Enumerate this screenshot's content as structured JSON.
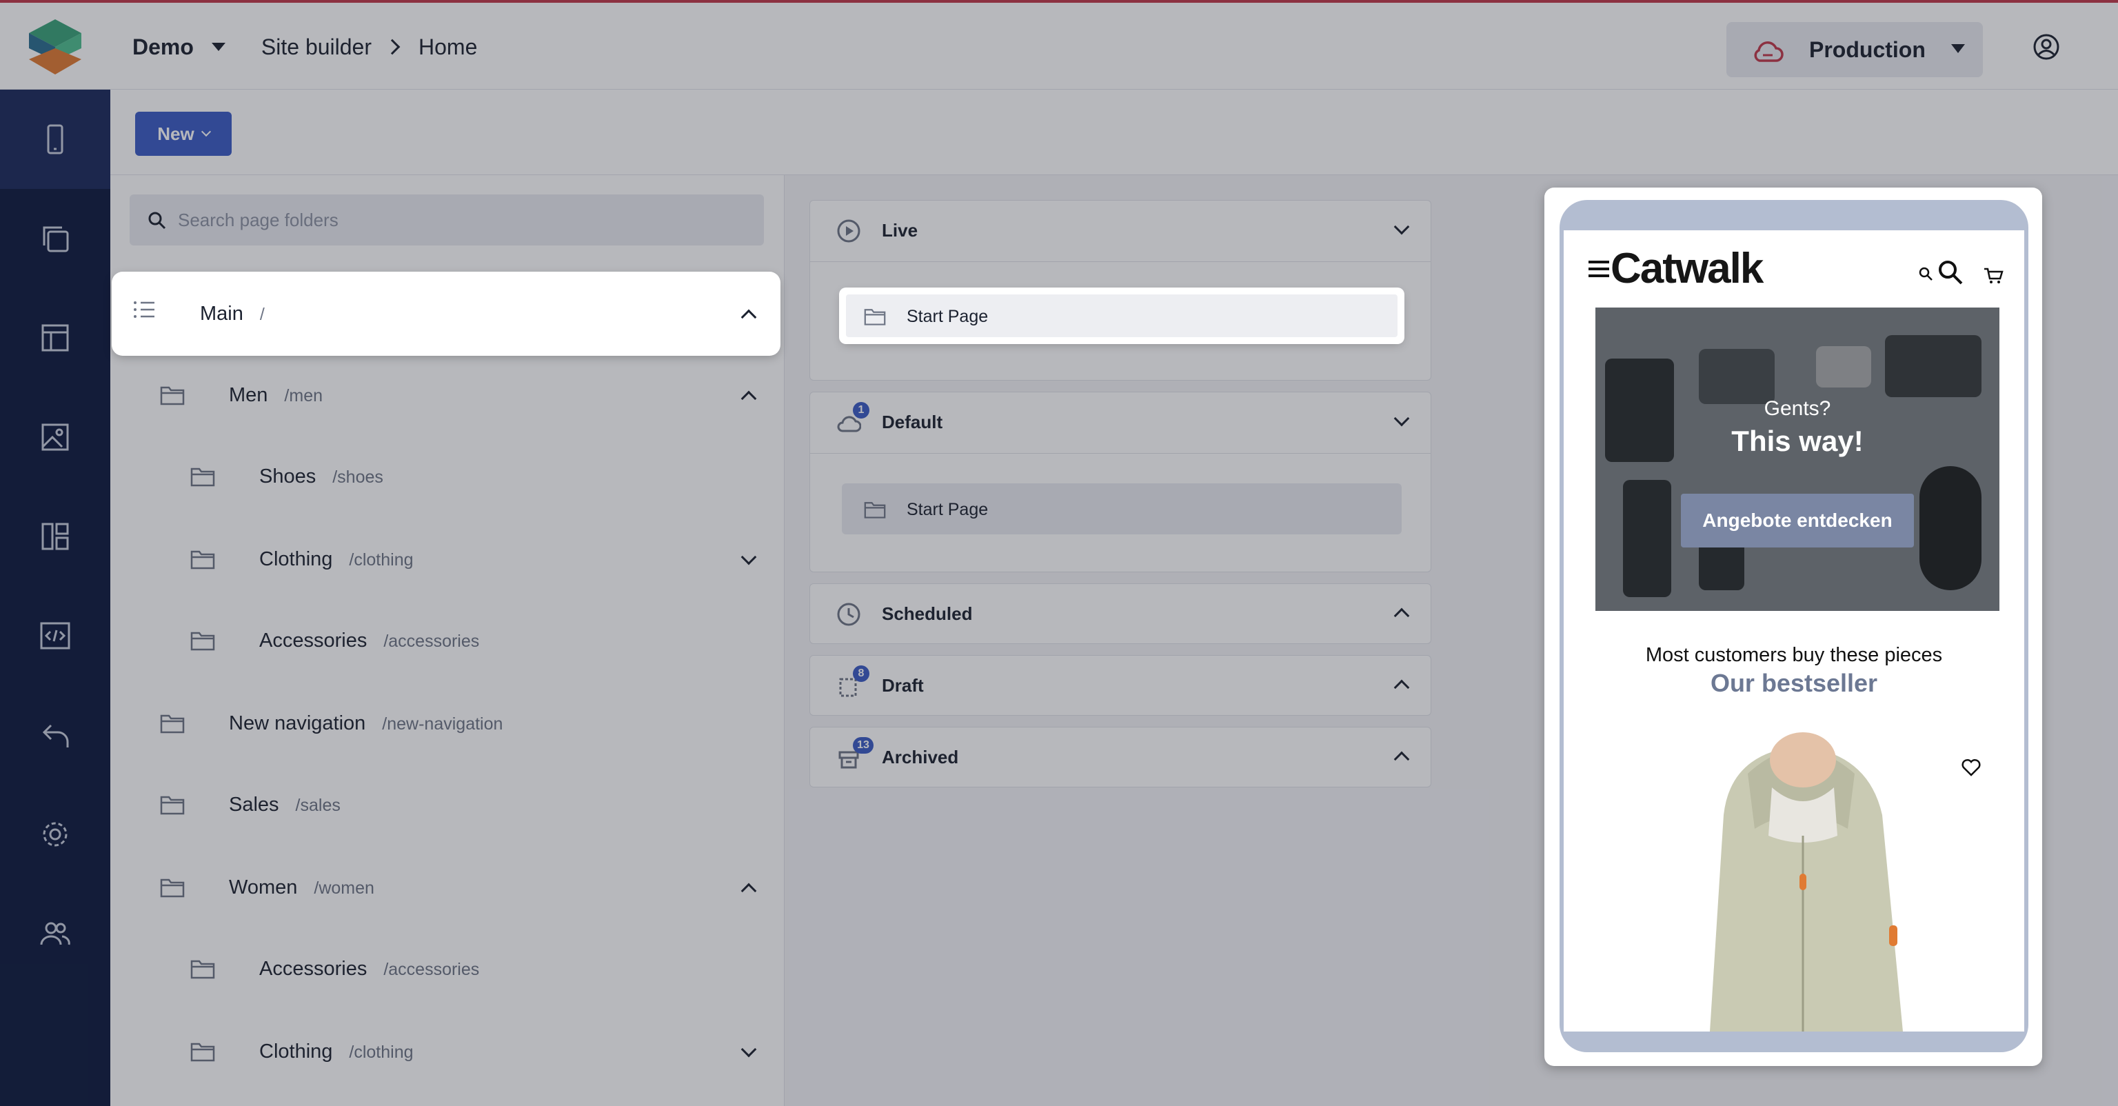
{
  "header": {
    "project": "Demo",
    "breadcrumb_section": "Site builder",
    "breadcrumb_page": "Home",
    "environment": "Production"
  },
  "toolbar": {
    "new_label": "New"
  },
  "rail": {
    "items": [
      "mobile-icon",
      "copy-icon",
      "layout-icon",
      "image-icon",
      "dashboard-icon",
      "code-icon",
      "undo-icon",
      "settings-icon",
      "users-icon"
    ]
  },
  "tree": {
    "search_placeholder": "Search page folders",
    "rows": [
      {
        "name": "Main",
        "path": "/",
        "state": "expanded"
      },
      {
        "name": "Men",
        "path": "/men",
        "state": "expanded"
      },
      {
        "name": "Shoes",
        "path": "/shoes"
      },
      {
        "name": "Clothing",
        "path": "/clothing",
        "state": "collapsed"
      },
      {
        "name": "Accessories",
        "path": "/accessories"
      },
      {
        "name": "New navigation",
        "path": "/new-navigation"
      },
      {
        "name": "Sales",
        "path": "/sales"
      },
      {
        "name": "Women",
        "path": "/women",
        "state": "expanded"
      },
      {
        "name": "Accessories",
        "path": "/accessories"
      },
      {
        "name": "Clothing",
        "path": "/clothing",
        "state": "collapsed"
      }
    ]
  },
  "states": {
    "live": {
      "title": "Live",
      "page": "Start Page"
    },
    "default": {
      "title": "Default",
      "badge": "1",
      "page": "Start Page"
    },
    "scheduled": {
      "title": "Scheduled"
    },
    "draft": {
      "title": "Draft",
      "badge": "8"
    },
    "archived": {
      "title": "Archived",
      "badge": "13"
    }
  },
  "preview": {
    "brand": "Catwalk",
    "hero_sub": "Gents?",
    "hero_title": "This way!",
    "hero_cta": "Angebote entdecken",
    "tagline": "Most customers buy these pieces",
    "section_title": "Our bestseller"
  },
  "colors": {
    "accent": "#3b5cc4",
    "rail": "#0e1a3e",
    "top_border": "#c0394b",
    "env_cloud": "#c0394b"
  }
}
